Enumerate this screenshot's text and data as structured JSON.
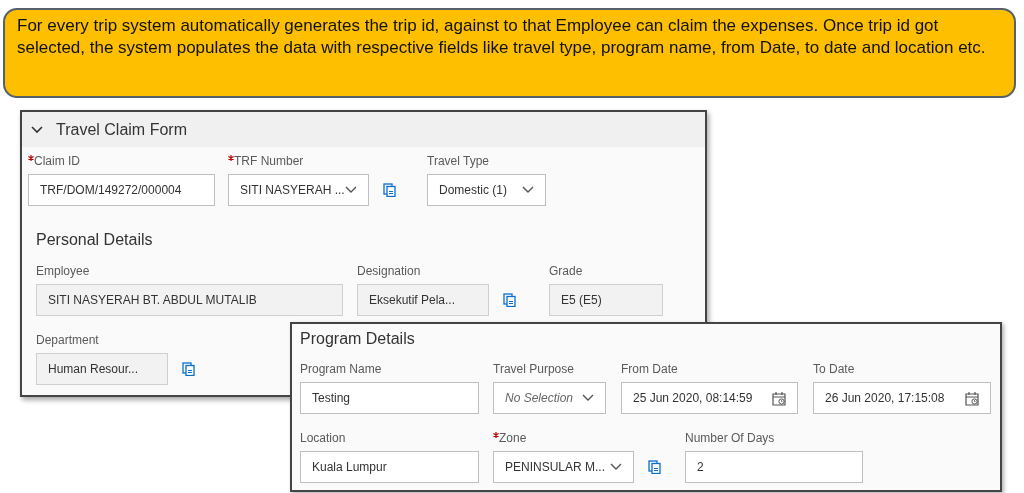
{
  "callout": {
    "text": "For every trip system automatically generates the trip id, against to that  Employee can claim the expenses. Once trip id got selected, the system populates the data with respective  fields like travel type, program name, from  Date, to date and location etc."
  },
  "travel_claim_form": {
    "title": "Travel Claim Form",
    "expanded": true,
    "rows": [
      {
        "fields": [
          {
            "kind": "input",
            "label": "Claim ID",
            "required": true,
            "value": "TRF/DOM/149272/000004",
            "value_help": false
          },
          {
            "kind": "select",
            "label": "TRF Number",
            "required": true,
            "value": "SITI NASYERAH ...",
            "value_help": true
          },
          {
            "kind": "select",
            "label": "Travel Type",
            "required": false,
            "value": "Domestic (1)",
            "value_help": false
          }
        ]
      }
    ],
    "personal_details": {
      "title": "Personal Details",
      "rows": [
        {
          "fields": [
            {
              "kind": "readonly",
              "label": "Employee",
              "required": false,
              "value": "SITI NASYERAH BT. ABDUL MUTALIB",
              "value_help": false
            },
            {
              "kind": "readonly",
              "label": "Designation",
              "required": false,
              "value": "Eksekutif Pela...",
              "value_help": true
            },
            {
              "kind": "readonly",
              "label": "Grade",
              "required": false,
              "value": "E5 (E5)",
              "value_help": false
            }
          ]
        },
        {
          "fields": [
            {
              "kind": "readonly",
              "label": "Department",
              "required": false,
              "value": "Human Resour...",
              "value_help": true
            }
          ]
        }
      ]
    }
  },
  "program_details": {
    "title": "Program Details",
    "rows": [
      {
        "fields": [
          {
            "kind": "input",
            "label": "Program Name",
            "required": false,
            "value": "Testing",
            "value_help": false
          },
          {
            "kind": "select",
            "label": "Travel Purpose",
            "required": false,
            "placeholder": "No Selection",
            "value_help": false
          },
          {
            "kind": "date",
            "label": "From Date",
            "required": false,
            "value": "25 Jun 2020, 08:14:59",
            "value_help": false
          },
          {
            "kind": "date",
            "label": "To Date",
            "required": false,
            "value": "26 Jun 2020, 17:15:08",
            "value_help": false
          }
        ]
      },
      {
        "fields": [
          {
            "kind": "input",
            "label": "Location",
            "required": false,
            "value": "Kuala Lumpur",
            "value_help": false
          },
          {
            "kind": "select",
            "label": "Zone",
            "required": true,
            "value": "PENINSULAR M...",
            "value_help": true
          },
          {
            "kind": "input",
            "label": "Number Of Days",
            "required": false,
            "value": "2",
            "value_help": false
          }
        ]
      }
    ]
  }
}
